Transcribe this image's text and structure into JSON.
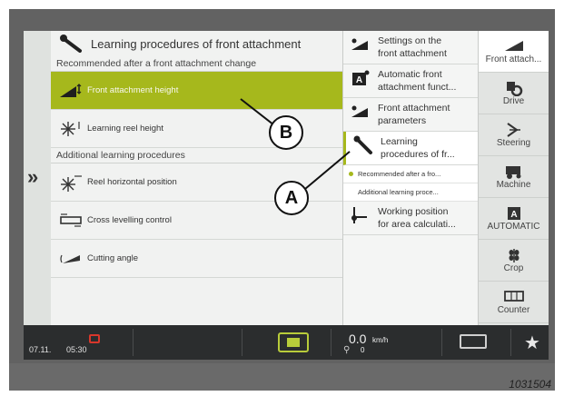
{
  "main": {
    "header_title": "Learning procedures of front attachment",
    "recommended_label": "Recommended after a front attachment change",
    "recommended_items": [
      {
        "label": "Front attachment height",
        "icon": "header-height-icon",
        "selected": true
      },
      {
        "label": "Learning reel height",
        "icon": "reel-height-icon",
        "selected": false
      }
    ],
    "additional_label": "Additional learning procedures",
    "additional_items": [
      {
        "label": "Reel horizontal position",
        "icon": "reel-horizontal-icon"
      },
      {
        "label": "Cross levelling control",
        "icon": "cross-levelling-icon"
      },
      {
        "label": "Cutting angle",
        "icon": "cutting-angle-icon"
      }
    ]
  },
  "submenu": {
    "items": [
      {
        "label_line1": "Settings on the",
        "label_line2": "front attachment",
        "icon": "front-attachment-settings-icon"
      },
      {
        "label_line1": "Automatic front",
        "label_line2": "attachment funct...",
        "icon": "automatic-icon"
      },
      {
        "label_line1": "Front attachment",
        "label_line2": "parameters",
        "icon": "front-attachment-params-icon"
      },
      {
        "label_line1": "Learning",
        "label_line2": "procedures of fr...",
        "icon": "learning-icon",
        "active": true
      },
      {
        "label_line1": "Working position",
        "label_line2": "for area calculati...",
        "icon": "working-position-icon"
      }
    ],
    "sub_items": [
      {
        "label": "Recommended after a fro...",
        "bullet": true
      },
      {
        "label": "Additional learning proce...",
        "bullet": false
      }
    ]
  },
  "tabs": [
    {
      "label": "Front attach...",
      "icon": "front-attach-icon",
      "active": true
    },
    {
      "label": "Drive",
      "icon": "drive-icon",
      "active": false
    },
    {
      "label": "Steering",
      "icon": "steering-icon",
      "active": false
    },
    {
      "label": "Machine",
      "icon": "machine-icon",
      "active": false
    },
    {
      "label": "AUTOMATIC",
      "icon": "automatic-tab-icon",
      "active": false
    },
    {
      "label": "Crop",
      "icon": "crop-icon",
      "active": false
    },
    {
      "label": "Counter",
      "icon": "counter-icon",
      "active": false
    }
  ],
  "status": {
    "date": "07.11.",
    "time": "05:30",
    "speed": "0.0",
    "speed_unit": "km/h",
    "gear": "0"
  },
  "callouts": {
    "a": "A",
    "b": "B"
  },
  "doc_number": "1031504",
  "colors": {
    "accent": "#a6b81c",
    "status_bar": "#2b2d2e",
    "bezel": "#626262"
  }
}
